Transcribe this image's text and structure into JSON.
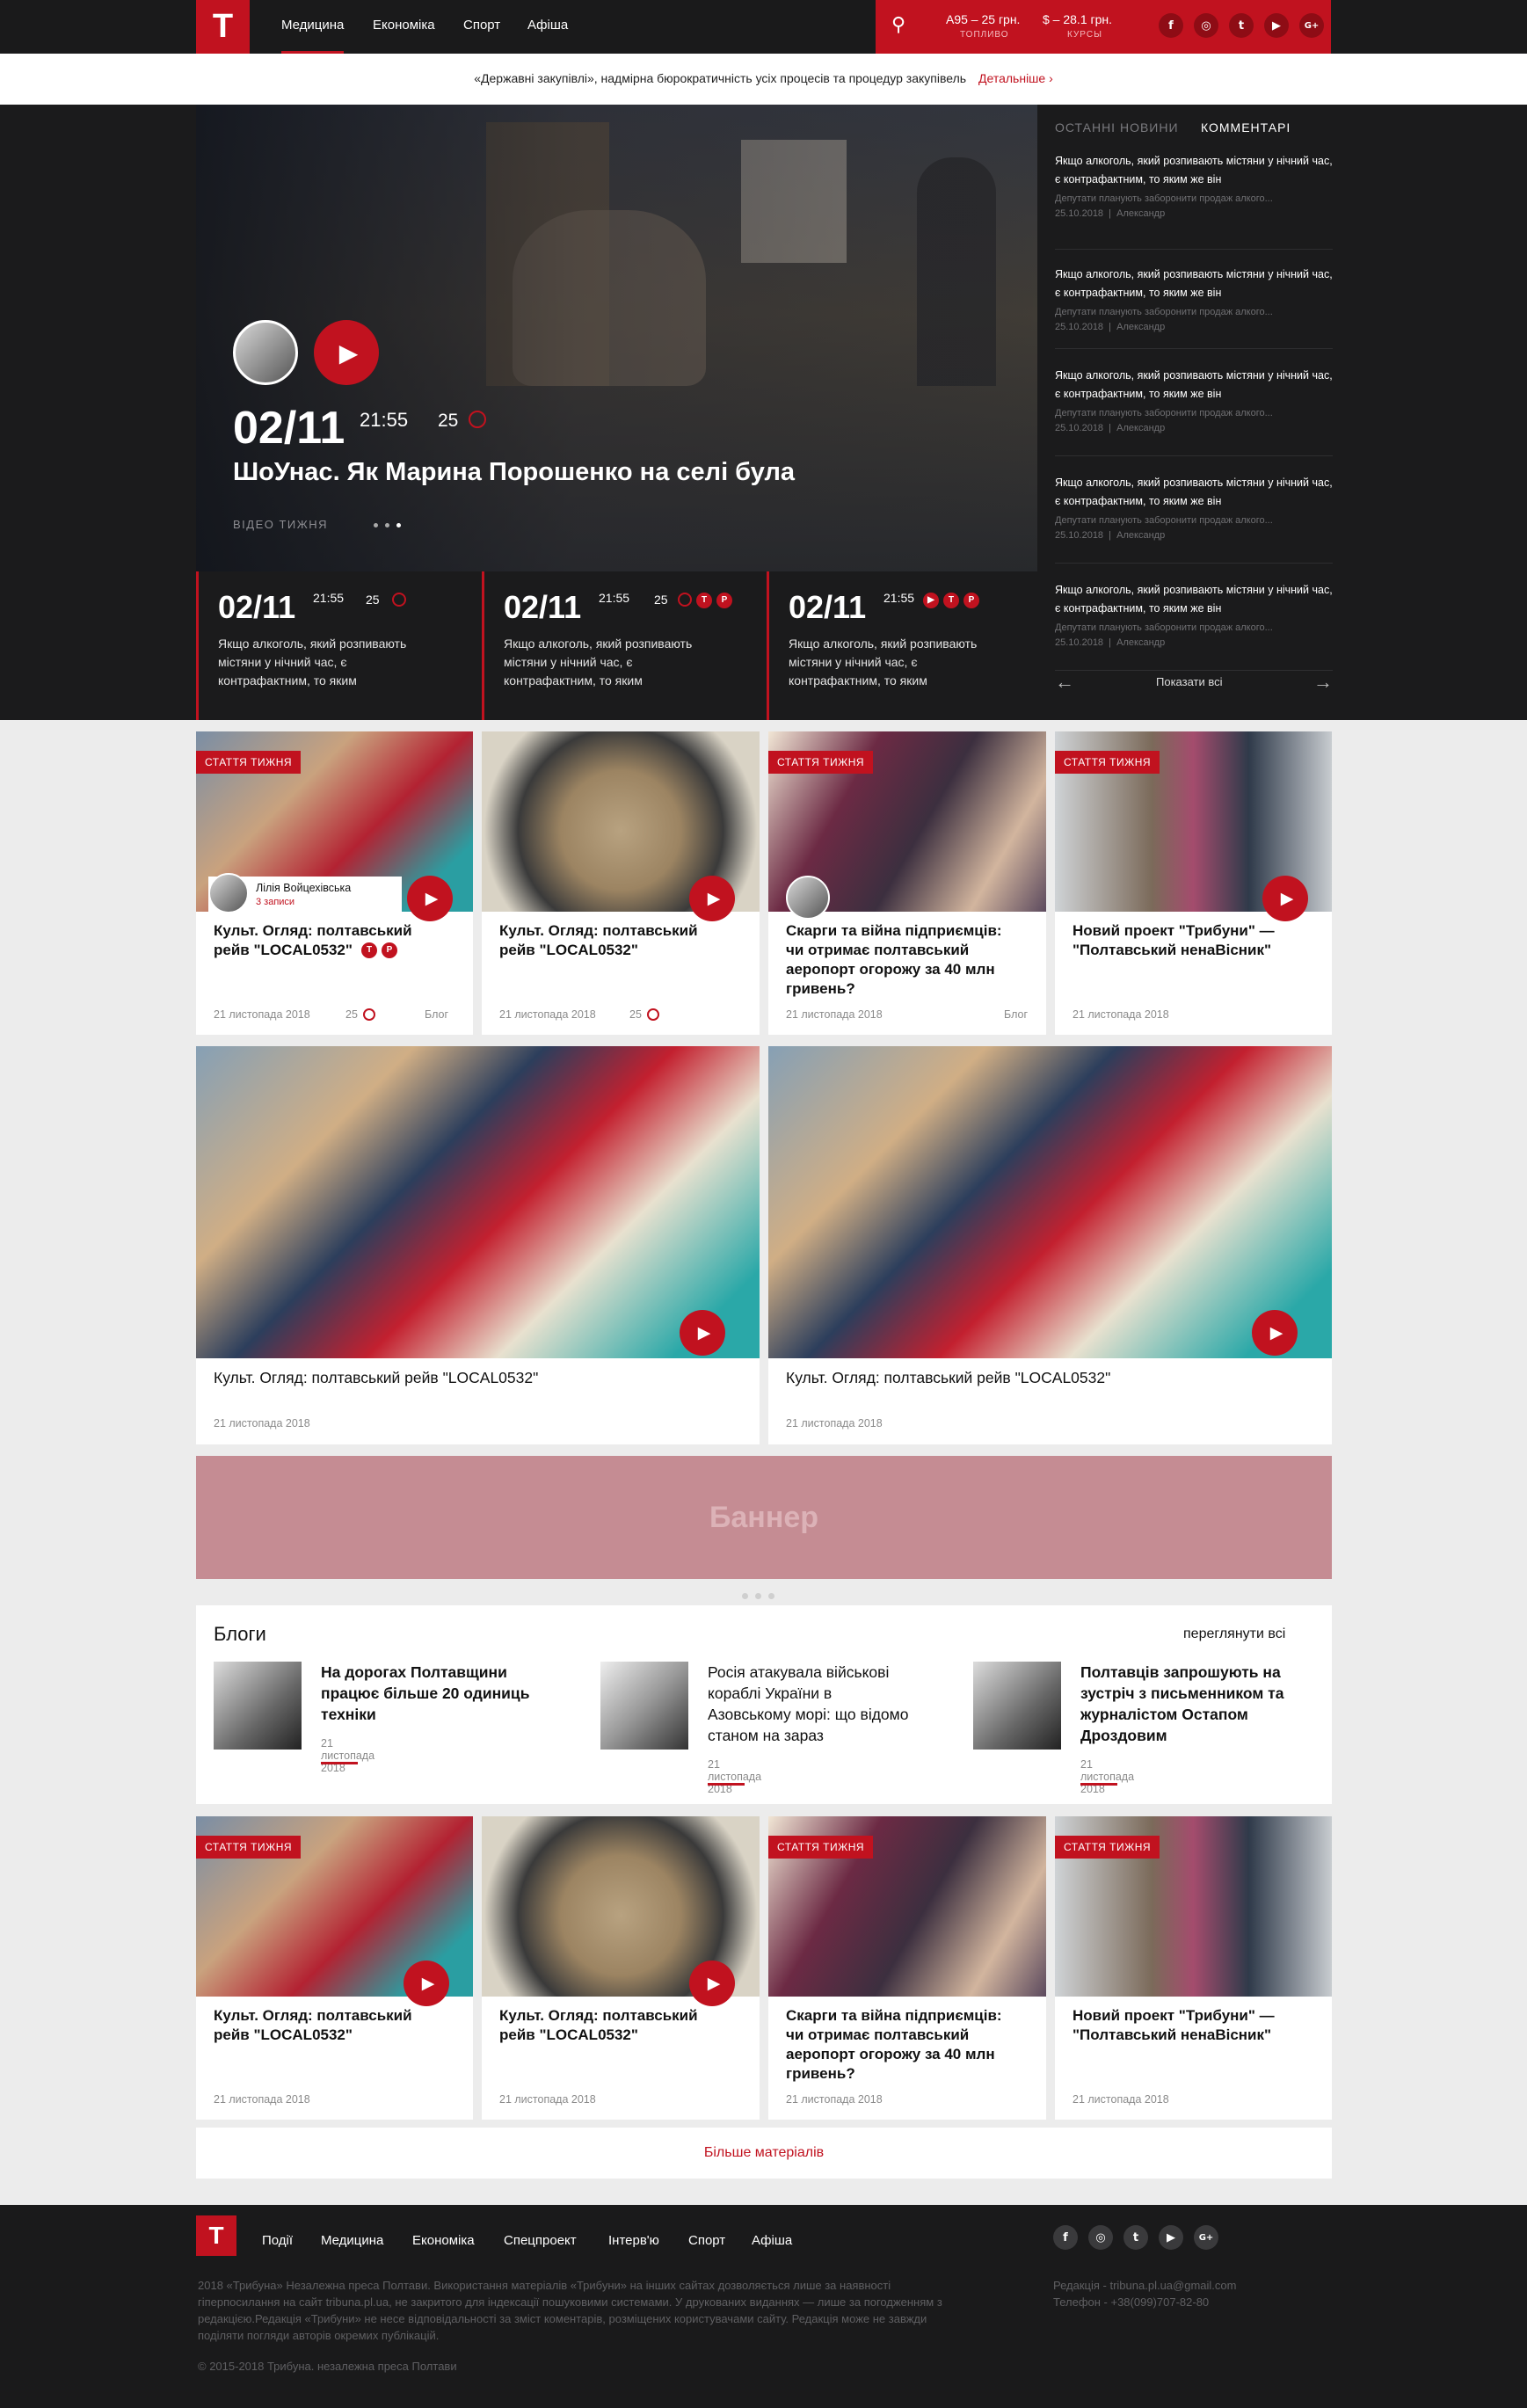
{
  "logo": "T",
  "nav": [
    "Медицина",
    "Економіка",
    "Спорт",
    "Афіша"
  ],
  "fuel": {
    "value": "А95 – 25 грн.",
    "label": "ТОПЛИВО"
  },
  "rates": {
    "value": "$ – 28.1 грн.",
    "label": "КУРСЫ"
  },
  "social": [
    "f",
    "◎",
    "t",
    "▶",
    "G+"
  ],
  "ticker": {
    "text": "«Державні закупівлі», надмірна бюрократичність усіх процесів та процедур закупівель",
    "link": "Детальніше ›"
  },
  "hero": {
    "date": "02/11",
    "time": "21:55",
    "comments": "25",
    "title": "ШоУнас. Як Марина Порошенко на селі була",
    "label": "ВІДЕО ТИЖНЯ"
  },
  "minis": [
    {
      "date": "02/11",
      "time": "21:55",
      "comments": "25",
      "text": "Якщо алкоголь, який розпивають містяни у нічний час, є контрафактним, то яким"
    },
    {
      "date": "02/11",
      "time": "21:55",
      "comments": "25",
      "text": "Якщо алкоголь, який розпивають містяни у нічний час, є контрафактним, то яким"
    },
    {
      "date": "02/11",
      "time": "21:55",
      "comments": "",
      "text": "Якщо алкоголь, який розпивають містяни у нічний час, є контрафактним, то яким"
    }
  ],
  "sidebar": {
    "tabs": [
      "ОСТАННІ НОВИНИ",
      "КОММЕНТАРІ"
    ],
    "items": [
      {
        "title": "Якщо алкоголь, який розпивають містяни у нічний час, є контрафактним, то яким же він",
        "excerpt": "Депутати планують заборонити продаж алкого...",
        "date": "25.10.2018",
        "author": "Александр"
      },
      {
        "title": "Якщо алкоголь, який розпивають містяни у нічний час, є контрафактним, то яким же він",
        "excerpt": "Депутати планують заборонити продаж алкого...",
        "date": "25.10.2018",
        "author": "Александр"
      },
      {
        "title": "Якщо алкоголь, який розпивають містяни у нічний час, є контрафактним, то яким же він",
        "excerpt": "Депутати планують заборонити продаж алкого...",
        "date": "25.10.2018",
        "author": "Александр"
      },
      {
        "title": "Якщо алкоголь, який розпивають містяни у нічний час, є контрафактним, то яким же він",
        "excerpt": "Депутати планують заборонити продаж алкого...",
        "date": "25.10.2018",
        "author": "Александр"
      },
      {
        "title": "Якщо алкоголь, який розпивають містяни у нічний час, є контрафактним, то яким же він",
        "excerpt": "Депутати планують заборонити продаж алкого...",
        "date": "25.10.2018",
        "author": "Александр"
      }
    ],
    "show_all": "Показати всі"
  },
  "row1": [
    {
      "badge": "СТАТТЯ ТИЖНЯ",
      "title": "Культ. Огляд: полтавський рейв \"LOCAL0532\"",
      "date": "21 листопада 2018",
      "comments": "25",
      "tag": "Блог",
      "author": "Лілія Войцехівська",
      "author_sub": "3 записи"
    },
    {
      "badge": "",
      "title": "Культ. Огляд: полтавський рейв \"LOCAL0532\"",
      "date": "21 листопада 2018",
      "comments": "25",
      "tag": ""
    },
    {
      "badge": "СТАТТЯ ТИЖНЯ",
      "title": "Скарги та війна підприємців: чи отримає полтавський аеропорт огорожу за 40 млн гривень?",
      "date": "21 листопада 2018",
      "comments": "",
      "tag": "Блог"
    },
    {
      "badge": "СТАТТЯ ТИЖНЯ",
      "title": "Новий проект \"Трибуни\" — \"Полтавський ненаВісник\"",
      "date": "21 листопада 2018",
      "comments": "",
      "tag": ""
    }
  ],
  "big": [
    {
      "title": "Культ. Огляд: полтавський рейв \"LOCAL0532\"",
      "date": "21 листопада 2018"
    },
    {
      "title": "Культ. Огляд: полтавський рейв \"LOCAL0532\"",
      "date": "21 листопада 2018"
    }
  ],
  "banner": "Баннер",
  "blogs": {
    "title": "Блоги",
    "view_all": "переглянути всі",
    "items": [
      {
        "title": "На дорогах Полтавщини працює більше 20 одиниць техніки",
        "date": "21 листопада 2018"
      },
      {
        "title": "Росія атакувала військові кораблі України в Азовському морі: що відомо станом на зараз",
        "date": "21 листопада 2018"
      },
      {
        "title": "Полтавців запрошують на зустріч з письменником та журналістом Остапом Дроздовим",
        "date": "21 листопада 2018"
      }
    ]
  },
  "row2": [
    {
      "badge": "СТАТТЯ ТИЖНЯ",
      "title": "Культ. Огляд: полтавський рейв \"LOCAL0532\"",
      "date": "21 листопада 2018"
    },
    {
      "badge": "",
      "title": "Культ. Огляд: полтавський рейв \"LOCAL0532\"",
      "date": "21 листопада 2018"
    },
    {
      "badge": "СТАТТЯ ТИЖНЯ",
      "title": "Скарги та війна підприємців: чи отримає полтавський аеропорт огорожу за 40 млн гривень?",
      "date": "21 листопада 2018"
    },
    {
      "badge": "СТАТТЯ ТИЖНЯ",
      "title": "Новий проект \"Трибуни\" — \"Полтавський ненаВісник\"",
      "date": "21 листопада 2018"
    }
  ],
  "more": "Більше матеріалів",
  "footer": {
    "nav": [
      "Події",
      "Медицина",
      "Економіка",
      "Спецпроект",
      "Інтерв'ю",
      "Спорт",
      "Афіша"
    ],
    "legal": "2018 «Трибуна» Незалежна преса Полтави. Використання матеріалів «Трибуни» на інших сайтах дозволяється лише за наявності гіперпосилання на сайт tribuna.pl.ua, не закритого для індексації пошуковими системами. У друкованих виданнях — лише за погодженням з редакцією.Редакція «Трибуни» не несе відповідальності за зміст коментарів, розміщених користувачами сайту. Редакція може не завжди поділяти погляди авторів окремих публікацій.",
    "email": "Редакція - tribuna.pl.ua@gmail.com",
    "phone": "Телефон - +38(099)707-82-80",
    "copyright": "© 2015-2018 Трибуна. незалежна преса Полтави"
  }
}
